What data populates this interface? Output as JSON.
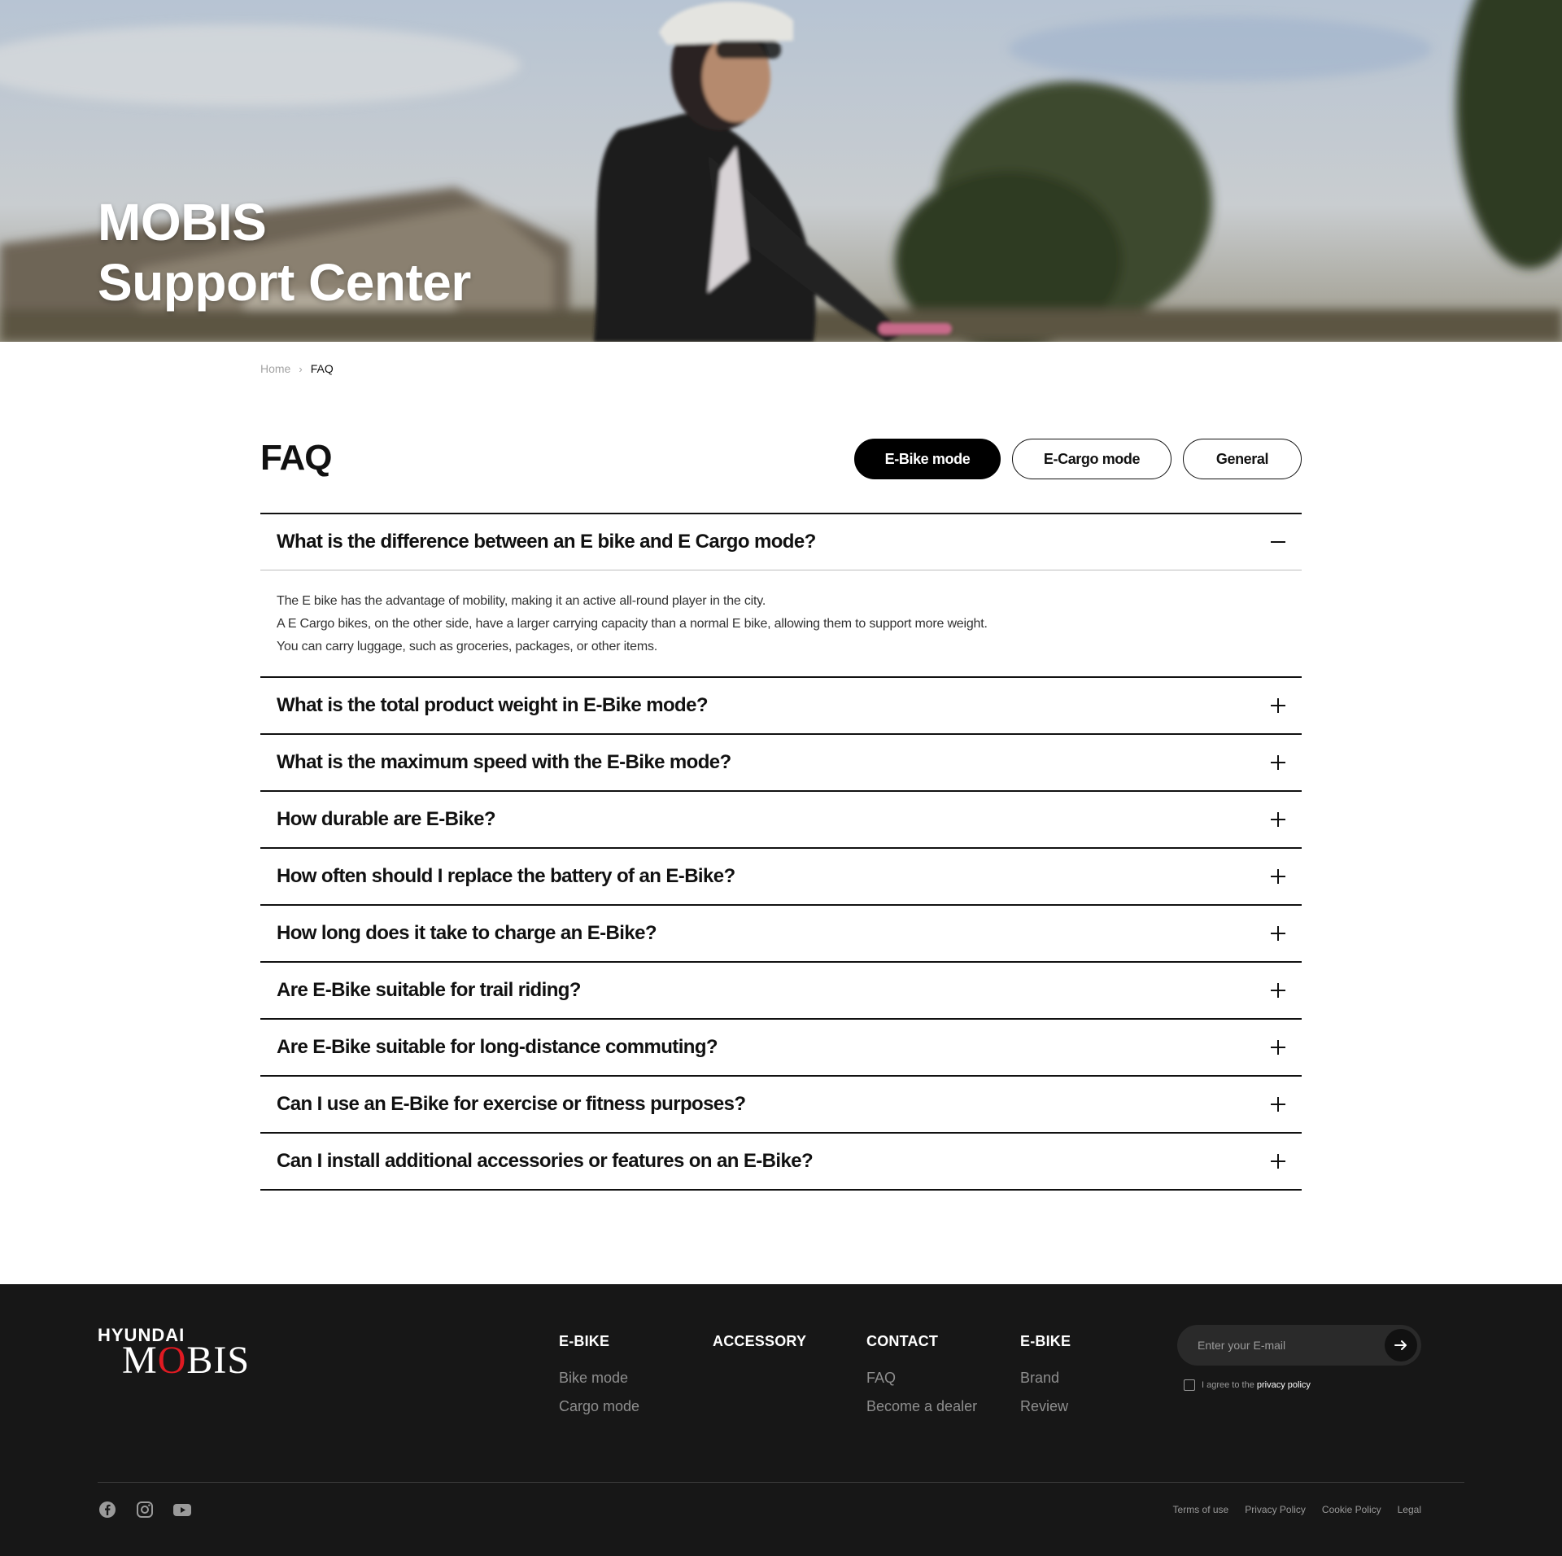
{
  "hero": {
    "title_line1": "MOBIS",
    "title_line2": "Support Center"
  },
  "breadcrumb": {
    "home": "Home",
    "current": "FAQ"
  },
  "faq": {
    "title": "FAQ",
    "tabs": [
      {
        "label": "E-Bike mode",
        "active": true
      },
      {
        "label": "E-Cargo mode",
        "active": false
      },
      {
        "label": "General",
        "active": false
      }
    ],
    "items": [
      {
        "question": "What is the difference between an E bike and E Cargo mode?",
        "open": true,
        "answer": [
          "The E bike has the advantage of mobility, making it an active all-round player in the city.",
          "A E Cargo bikes, on the other side, have a larger carrying capacity than a normal E bike, allowing them to support more weight.",
          "You can carry luggage, such as groceries, packages, or other items."
        ]
      },
      {
        "question": "What is the total product weight in E-Bike mode?",
        "open": false
      },
      {
        "question": "What is the maximum speed with the E-Bike mode?",
        "open": false
      },
      {
        "question": "How durable are E-Bike?",
        "open": false
      },
      {
        "question": "How often should I replace the battery of an E-Bike?",
        "open": false
      },
      {
        "question": "How long does it take to charge an E-Bike?",
        "open": false
      },
      {
        "question": "Are E-Bike suitable for trail riding?",
        "open": false
      },
      {
        "question": "Are E-Bike suitable for long-distance commuting?",
        "open": false
      },
      {
        "question": "Can I use an E-Bike for exercise or fitness purposes?",
        "open": false
      },
      {
        "question": "Can I install additional accessories or features on an E-Bike?",
        "open": false
      }
    ]
  },
  "footer": {
    "logo": {
      "top": "HYUNDAI",
      "main_prefix": "M",
      "main_o": "O",
      "main_suffix": "BIS"
    },
    "columns": [
      {
        "heading": "E-BIKE",
        "links": [
          "Bike mode",
          "Cargo mode"
        ]
      },
      {
        "heading": "ACCESSORY",
        "links": []
      },
      {
        "heading": "CONTACT",
        "links": [
          "FAQ",
          "Become a dealer"
        ]
      },
      {
        "heading": "E-BIKE",
        "links": [
          "Brand",
          "Review"
        ]
      }
    ],
    "newsletter": {
      "placeholder": "Enter your E-mail",
      "agree_prefix": "I agree to the ",
      "agree_link": "privacy policy"
    },
    "socials": [
      "facebook-icon",
      "instagram-icon",
      "youtube-icon"
    ],
    "legal": [
      "Terms of use",
      "Privacy Policy",
      "Cookie Policy",
      "Legal"
    ]
  },
  "colors": {
    "accent_black": "#000000",
    "footer_bg": "#171717",
    "logo_red": "#e01a22"
  }
}
